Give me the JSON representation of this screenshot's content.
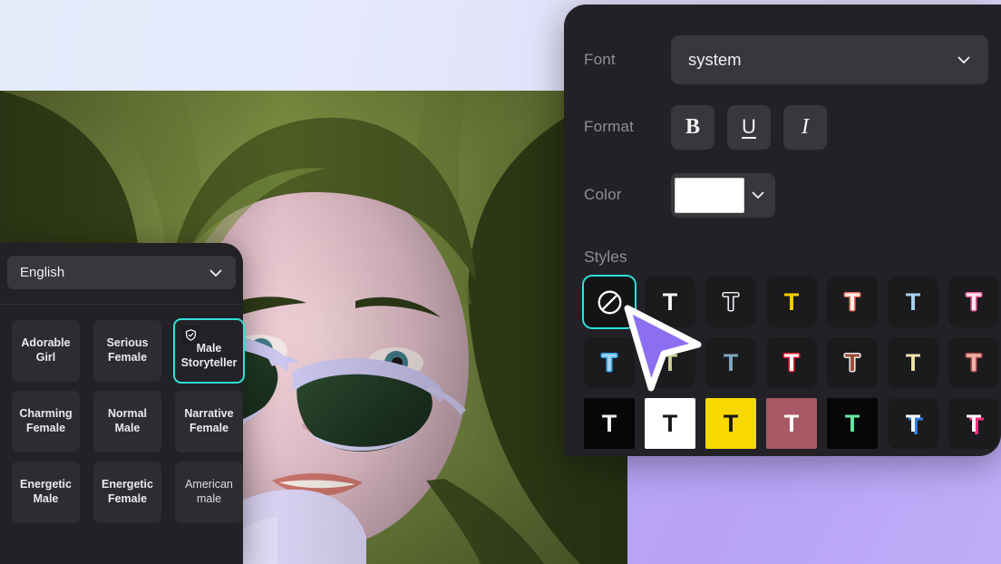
{
  "right_panel": {
    "font": {
      "label": "Font",
      "value": "system",
      "chevron_icon": "chevron-down-icon"
    },
    "format": {
      "label": "Format",
      "buttons": [
        {
          "name": "bold",
          "glyph": "B"
        },
        {
          "name": "underline",
          "glyph": "U"
        },
        {
          "name": "italic",
          "glyph": "I"
        }
      ]
    },
    "color": {
      "label": "Color",
      "value": "#ffffff",
      "chevron_icon": "chevron-down-icon"
    },
    "styles": {
      "label": "Styles",
      "selected_index": 0,
      "accent": "#2fe0d8",
      "tiles": [
        {
          "name": "no-style",
          "icon": "ban-icon",
          "tile_bg": "#141416",
          "fill": "#ffffff",
          "stroke": "",
          "shadow": "",
          "selected": true,
          "square": false
        },
        {
          "name": "plain-white",
          "glyph": "T",
          "tile_bg": "#1b1b1e",
          "fill": "#f4f4f6",
          "stroke": "",
          "shadow": "",
          "selected": false,
          "square": false
        },
        {
          "name": "outline-white",
          "glyph": "T",
          "tile_bg": "#1b1b1e",
          "fill": "#1b1b1e",
          "stroke": "#e9e9ee",
          "shadow": "",
          "selected": false,
          "square": false
        },
        {
          "name": "solid-yellow",
          "glyph": "T",
          "tile_bg": "#1b1b1e",
          "fill": "#f5cf00",
          "stroke": "",
          "shadow": "",
          "selected": false,
          "square": false
        },
        {
          "name": "white-coral-outline",
          "glyph": "T",
          "tile_bg": "#1b1b1e",
          "fill": "#fdf2ee",
          "stroke": "#e8705c",
          "shadow": "",
          "selected": false,
          "square": false
        },
        {
          "name": "light-blue",
          "glyph": "T",
          "tile_bg": "#1b1b1e",
          "fill": "#a9d2ef",
          "stroke": "",
          "shadow": "",
          "selected": false,
          "square": false
        },
        {
          "name": "white-pink-outline",
          "glyph": "T",
          "tile_bg": "#1b1b1e",
          "fill": "#fbe9f1",
          "stroke": "#ec5d95",
          "shadow": "",
          "selected": false,
          "square": false
        },
        {
          "name": "glow-blue",
          "glyph": "T",
          "tile_bg": "#1b1b1e",
          "fill": "#9ed4f7",
          "stroke": "#3aa3e8",
          "shadow": "",
          "selected": false,
          "square": false
        },
        {
          "name": "hidden-by-cursor",
          "glyph": "T",
          "tile_bg": "#1b1b1e",
          "fill": "#cfcf9a",
          "stroke": "",
          "shadow": "",
          "selected": false,
          "square": false
        },
        {
          "name": "steel-blue",
          "glyph": "T",
          "tile_bg": "#1b1b1e",
          "fill": "#7fa7bd",
          "stroke": "",
          "shadow": "",
          "selected": false,
          "square": false
        },
        {
          "name": "white-red-outline",
          "glyph": "T",
          "tile_bg": "#1b1b1e",
          "fill": "#ffffff",
          "stroke": "#ef1f36",
          "shadow": "",
          "selected": false,
          "square": false
        },
        {
          "name": "rust-white-outline",
          "glyph": "T",
          "tile_bg": "#1b1b1e",
          "fill": "#9c4a33",
          "stroke": "#e7e7ea",
          "shadow": "",
          "selected": false,
          "square": false
        },
        {
          "name": "cream",
          "glyph": "T",
          "tile_bg": "#1b1b1e",
          "fill": "#efe3ad",
          "stroke": "",
          "shadow": "",
          "selected": false,
          "square": false
        },
        {
          "name": "salmon-outline",
          "glyph": "T",
          "tile_bg": "#1b1b1e",
          "fill": "#eeb2ab",
          "stroke": "#b4524e",
          "shadow": "",
          "selected": false,
          "square": false
        },
        {
          "name": "black-bg-white-t",
          "glyph": "T",
          "tile_bg": "#070708",
          "fill": "#f2f2f4",
          "stroke": "",
          "shadow": "",
          "selected": false,
          "square": true
        },
        {
          "name": "white-bg-black-t",
          "glyph": "T",
          "tile_bg": "#ffffff",
          "fill": "#16161a",
          "stroke": "",
          "shadow": "",
          "selected": false,
          "square": true
        },
        {
          "name": "yellow-bg-black-t",
          "glyph": "T",
          "tile_bg": "#f7d800",
          "fill": "#16161a",
          "stroke": "",
          "shadow": "",
          "selected": false,
          "square": true
        },
        {
          "name": "mauve-bg-white-t",
          "glyph": "T",
          "tile_bg": "#a85965",
          "fill": "#ffffff",
          "stroke": "",
          "shadow": "",
          "selected": false,
          "square": true
        },
        {
          "name": "black-bg-green-t",
          "glyph": "T",
          "tile_bg": "#070708",
          "fill": "#67e8a0",
          "stroke": "",
          "shadow": "",
          "selected": false,
          "square": true
        },
        {
          "name": "white-blue-shadow",
          "glyph": "T",
          "tile_bg": "#1b1b1e",
          "fill": "#ffffff",
          "stroke": "",
          "shadow": "#2f7fe0",
          "selected": false,
          "square": false
        },
        {
          "name": "white-pink-shadow",
          "glyph": "T",
          "tile_bg": "#1b1b1e",
          "fill": "#ffffff",
          "stroke": "",
          "shadow": "#f0327e",
          "selected": false,
          "square": false
        }
      ]
    }
  },
  "left_panel": {
    "language": {
      "value": "English",
      "chevron_icon": "chevron-down-icon"
    },
    "voices": [
      {
        "name": "adorable-girl",
        "label": "Adorable Girl",
        "selected": false,
        "badge": false,
        "plain": false
      },
      {
        "name": "serious-female",
        "label": "Serious Female",
        "selected": false,
        "badge": false,
        "plain": false
      },
      {
        "name": "male-storyteller",
        "label": "Male Storyteller",
        "selected": true,
        "badge": true,
        "plain": true
      },
      {
        "name": "charming-female",
        "label": "Charming Female",
        "selected": false,
        "badge": false,
        "plain": false
      },
      {
        "name": "normal-male",
        "label": "Normal Male",
        "selected": false,
        "badge": false,
        "plain": false
      },
      {
        "name": "narrative-female",
        "label": "Narrative Female",
        "selected": false,
        "badge": false,
        "plain": false
      },
      {
        "name": "energetic-male",
        "label": "Energetic Male",
        "selected": false,
        "badge": false,
        "plain": false
      },
      {
        "name": "energetic-female",
        "label": "Energetic Female",
        "selected": false,
        "badge": false,
        "plain": false
      },
      {
        "name": "american-male",
        "label": "American male",
        "selected": false,
        "badge": false,
        "plain": true
      }
    ],
    "badge_icon": "shield-check-icon"
  },
  "cursor": {
    "icon": "arrow-pointer-cursor",
    "fill": "#8b6ff0",
    "outline": "#ffffff"
  }
}
